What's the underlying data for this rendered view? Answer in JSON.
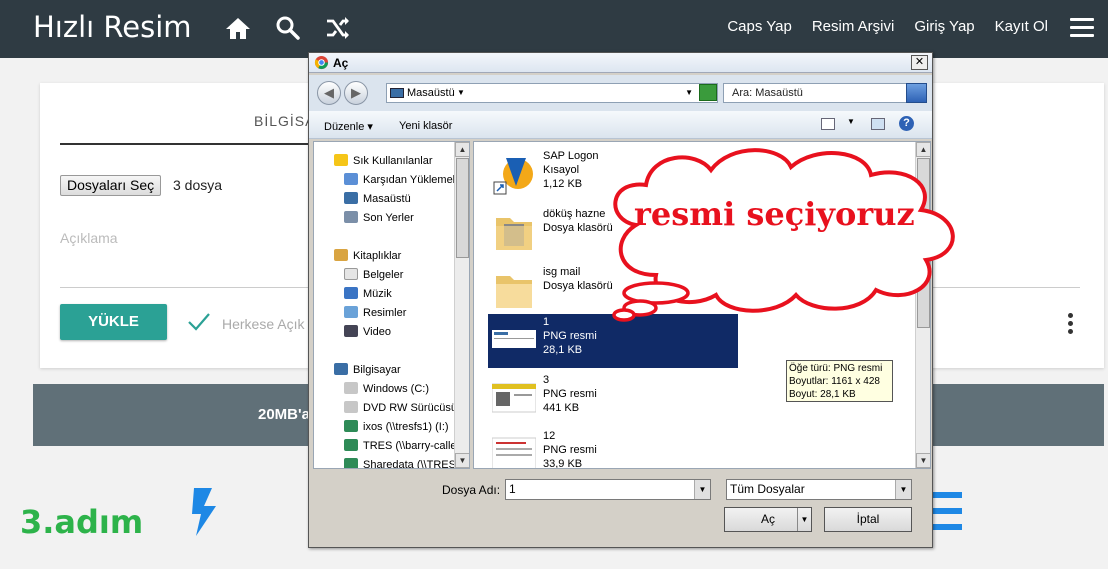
{
  "site": {
    "brand": "Hızlı Resim",
    "nav_links": [
      "Caps Yap",
      "Resim Arşivi",
      "Giriş Yap",
      "Kayıt Ol"
    ],
    "icons": [
      "home-icon",
      "search-icon",
      "shuffle-icon",
      "menu-icon"
    ]
  },
  "upload": {
    "tab_label": "BİLGİSA",
    "file_button": "Dosyaları Seç",
    "file_count": "3 dosya",
    "description_placeholder": "Açıklama",
    "upload_button": "YÜKLE",
    "public_label": "Herkese Açık",
    "size_note": "20MB'a"
  },
  "annotation": {
    "step": "3.adım",
    "callout": "resmi seçiyoruz",
    "callout_color": "#e8111e",
    "step_color": "#2db34a"
  },
  "dialog": {
    "title": "Aç",
    "location": "Masaüstü",
    "search_placeholder": "Ara: Masaüstü",
    "toolbar": {
      "organize": "Düzenle",
      "new_folder": "Yeni klasör"
    },
    "nav": {
      "favorites_header": "Sık Kullanılanlar",
      "favorites": [
        "Karşıdan Yüklemeler",
        "Masaüstü",
        "Son Yerler"
      ],
      "libraries_header": "Kitaplıklar",
      "libraries": [
        "Belgeler",
        "Müzik",
        "Resimler",
        "Video"
      ],
      "computer_header": "Bilgisayar",
      "drives": [
        "Windows (C:)",
        "DVD RW Sürücüsü",
        "ixos (\\\\tresfs1) (I:)",
        "TRES (\\\\barry-caller",
        "Sharedata (\\\\TRES"
      ]
    },
    "files": [
      {
        "name": "SAP Logon",
        "type": "Kısayol",
        "size": "1,12 KB"
      },
      {
        "name": "döküş hazne",
        "type": "Dosya klasörü",
        "size": ""
      },
      {
        "name": "isg mail",
        "type": "Dosya klasörü",
        "size": ""
      },
      {
        "name": "1",
        "type": "PNG resmi",
        "size": "28,1 KB"
      },
      {
        "name": "3",
        "type": "PNG resmi",
        "size": "441 KB"
      },
      {
        "name": "12",
        "type": "PNG resmi",
        "size": "33,9 KB"
      }
    ],
    "tooltip": {
      "type": "Öğe türü: PNG resmi",
      "dims": "Boyutlar: 1161 x 428",
      "size": "Boyut: 28,1 KB"
    },
    "filename_label": "Dosya Adı:",
    "filename_value": "1",
    "filter_value": "Tüm Dosyalar",
    "open_button": "Aç",
    "cancel_button": "İptal"
  }
}
